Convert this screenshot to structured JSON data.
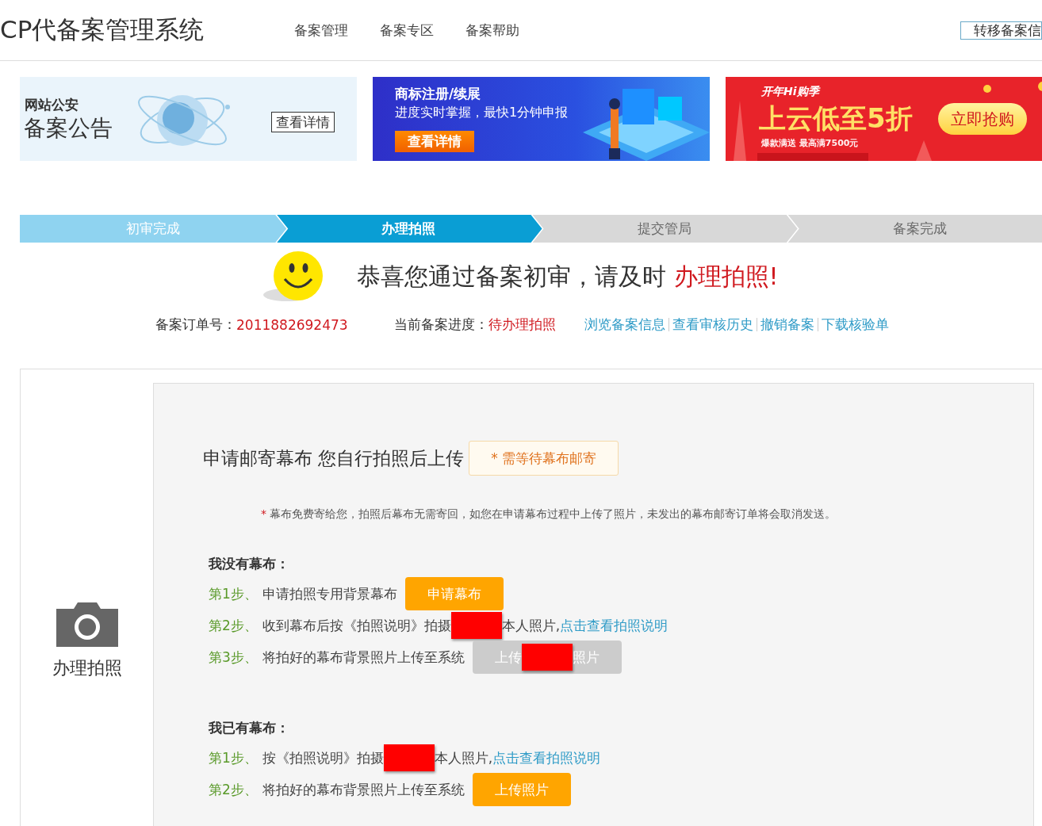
{
  "header": {
    "title": "CP代备案管理系统",
    "nav": [
      {
        "label": "备案管理"
      },
      {
        "label": "备案专区"
      },
      {
        "label": "备案帮助"
      }
    ],
    "action_button": "转移备案信"
  },
  "banners": [
    {
      "kind": "notice",
      "tag": "网站公安",
      "title": "备案公告",
      "button": "查看详情"
    },
    {
      "kind": "promo",
      "title": "商标注册/续展",
      "subtitle": "进度实时掌握，最快1分钟申报",
      "button": "查看详情"
    },
    {
      "kind": "sale",
      "tag": "开年Hi购季",
      "title": "上云低至5折",
      "note": "爆款满送 最高满7500元",
      "button": "立即抢购"
    }
  ],
  "steps": [
    {
      "label": "初审完成",
      "completed": true,
      "selected": false
    },
    {
      "label": "办理拍照",
      "completed": false,
      "selected": true
    },
    {
      "label": "提交管局",
      "completed": false,
      "selected": false
    },
    {
      "label": "备案完成",
      "completed": false,
      "selected": false
    }
  ],
  "message": {
    "text": "恭喜您通过备案初审，请及时",
    "highlight": "办理拍照!"
  },
  "order": {
    "label": "备案订单号：",
    "value": "2011882692473"
  },
  "progress": {
    "label": "当前备案进度：",
    "value": "待办理拍照"
  },
  "links": [
    "浏览备案信息",
    "查看审核历史",
    "撤销备案",
    "下载核验单"
  ],
  "side": {
    "label": "办理拍照"
  },
  "panel": {
    "heading": "申请邮寄幕布 您自行拍照后上传",
    "badge": "* 需等待幕布邮寄",
    "note_mark": "*",
    "note": "幕布免费寄给您，拍照后幕布无需寄回，如您在申请幕布过程中上传了照片，未发出的幕布邮寄订单将会取消发送。",
    "sections": [
      {
        "title": "我没有幕布：",
        "steps": [
          {
            "number": "第1步、",
            "text": "申请拍照专用背景幕布",
            "button": {
              "label": "申请幕布",
              "disabled": false
            }
          },
          {
            "number": "第2步、",
            "text": "收到幕布后按《拍照说明》拍摄",
            "redacted": true,
            "text_after": "本人照片,",
            "link": "点击查看拍照说明"
          },
          {
            "number": "第3步、",
            "text": "将拍好的幕布背景照片上传至系统",
            "button": {
              "label": "上传",
              "redacted": true,
              "label_after": "照片",
              "disabled": true
            }
          }
        ]
      },
      {
        "title": "我已有幕布：",
        "steps": [
          {
            "number": "第1步、",
            "text": "按《拍照说明》拍摄",
            "redacted": true,
            "text_after": "本人照片,",
            "link": "点击查看拍照说明"
          },
          {
            "number": "第2步、",
            "text": "将拍好的幕布背景照片上传至系统",
            "button": {
              "label": "上传照片",
              "disabled": false
            }
          }
        ]
      }
    ]
  }
}
